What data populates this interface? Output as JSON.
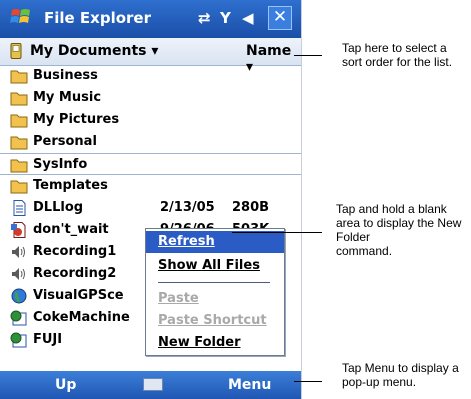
{
  "titlebar": {
    "title": "File Explorer",
    "icons": [
      "start-flag-icon",
      "connectivity-icon",
      "signal-icon",
      "speaker-icon",
      "close-icon"
    ],
    "close_glyph": "✕"
  },
  "header": {
    "folder_label": "My Documents",
    "sort_label": "Name",
    "dropdown_glyph": "▾"
  },
  "files": [
    {
      "name": "Business",
      "icon": "folder-icon"
    },
    {
      "name": "My Music",
      "icon": "folder-icon"
    },
    {
      "name": "My Pictures",
      "icon": "folder-icon"
    },
    {
      "name": "Personal",
      "icon": "folder-icon"
    },
    {
      "name": "SysInfo",
      "icon": "folder-icon"
    },
    {
      "name": "Templates",
      "icon": "folder-icon"
    },
    {
      "name": "DLLlog",
      "icon": "document-icon",
      "date": "2/13/05",
      "size": "280B"
    },
    {
      "name": "don't_wait",
      "icon": "media-file-icon",
      "date": "9/26/06",
      "size": "503K"
    },
    {
      "name": "Recording1",
      "icon": "audio-icon"
    },
    {
      "name": "Recording2",
      "icon": "audio-icon"
    },
    {
      "name": "VisualGPSce",
      "icon": "globe-icon"
    },
    {
      "name": "CokeMachine",
      "icon": "app-icon"
    },
    {
      "name": "FUJI",
      "icon": "app-icon"
    }
  ],
  "context_menu": {
    "items": [
      {
        "label": "Refresh",
        "state": "highlighted"
      },
      {
        "label": "Show All Files",
        "state": "enabled"
      },
      {
        "label": "Paste",
        "state": "disabled"
      },
      {
        "label": "Paste Shortcut",
        "state": "disabled"
      },
      {
        "label": "New Folder",
        "state": "enabled"
      }
    ]
  },
  "bottombar": {
    "left_label": "Up",
    "right_label": "Menu",
    "center_icon": "keyboard-icon"
  },
  "callouts": {
    "sort": "Tap here to select a sort order for the list.",
    "hold_line1": "Tap and hold a blank area to display the New Folder",
    "hold_line2": "command.",
    "menu": "Tap Menu to display a pop-up menu."
  },
  "colors": {
    "titlebar": "#1a4fa8",
    "highlight": "#2b5cc5",
    "folder": "#f2c14e"
  }
}
